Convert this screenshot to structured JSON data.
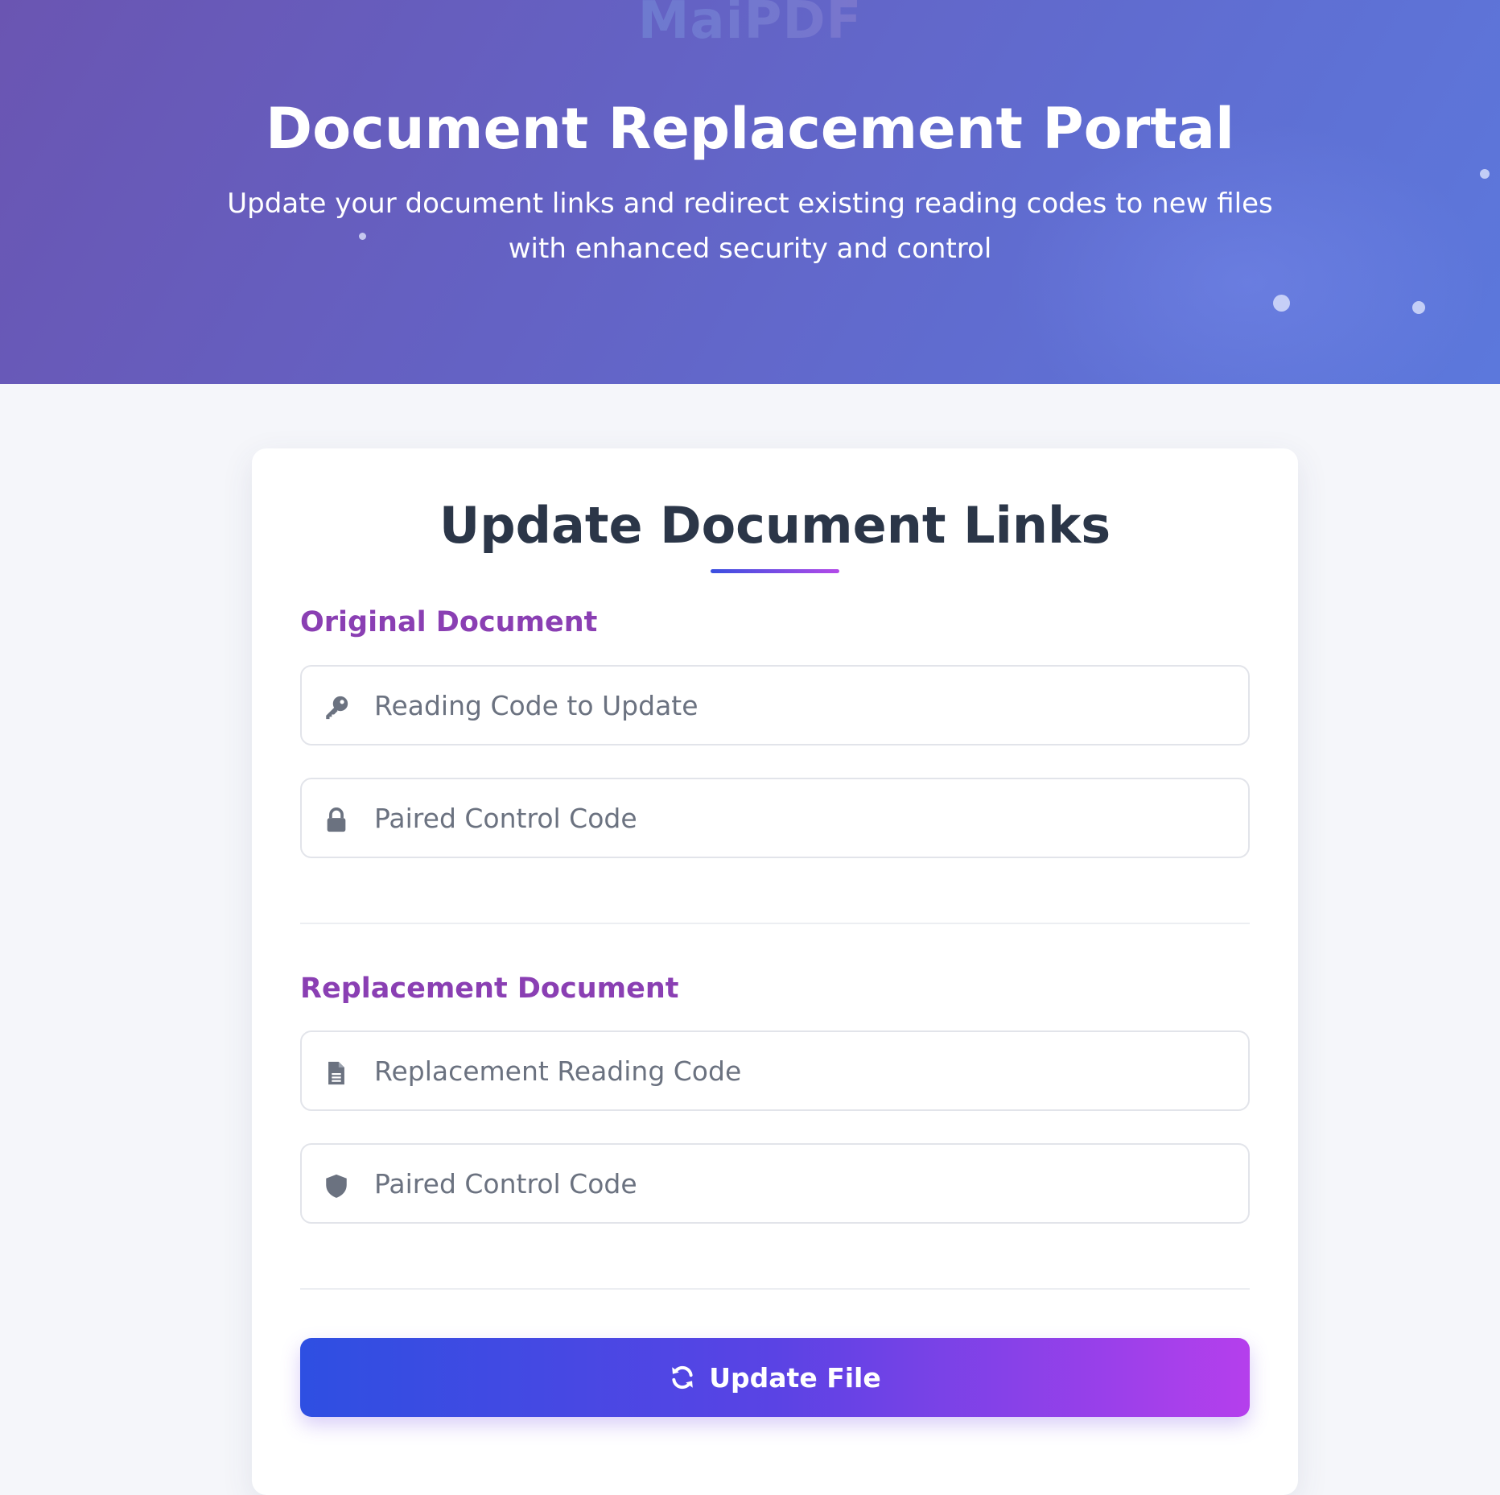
{
  "brand": {
    "logo_text": "MaiPDF"
  },
  "hero": {
    "title": "Document Replacement Portal",
    "subtitle": "Update your document links and redirect existing reading codes to new files with enhanced security and control"
  },
  "form": {
    "title": "Update Document Links",
    "original_section": {
      "heading": "Original Document",
      "reading_code": {
        "placeholder": "Reading Code to Update",
        "icon": "key-icon",
        "value": ""
      },
      "control_code": {
        "placeholder": "Paired Control Code",
        "icon": "lock-icon",
        "value": ""
      }
    },
    "replacement_section": {
      "heading": "Replacement Document",
      "reading_code": {
        "placeholder": "Replacement Reading Code",
        "icon": "file-icon",
        "value": ""
      },
      "control_code": {
        "placeholder": "Paired Control Code",
        "icon": "shield-icon",
        "value": ""
      }
    },
    "submit_label": "Update File",
    "submit_icon": "refresh-icon"
  },
  "colors": {
    "hero_gradient_start": "#6a55b2",
    "hero_gradient_end": "#5c78dc",
    "section_heading": "#8a3fb3",
    "button_gradient_start": "#2e4fe2",
    "button_gradient_end": "#b53fec",
    "title_text": "#2b3648",
    "icon_gray": "#6b7280"
  }
}
